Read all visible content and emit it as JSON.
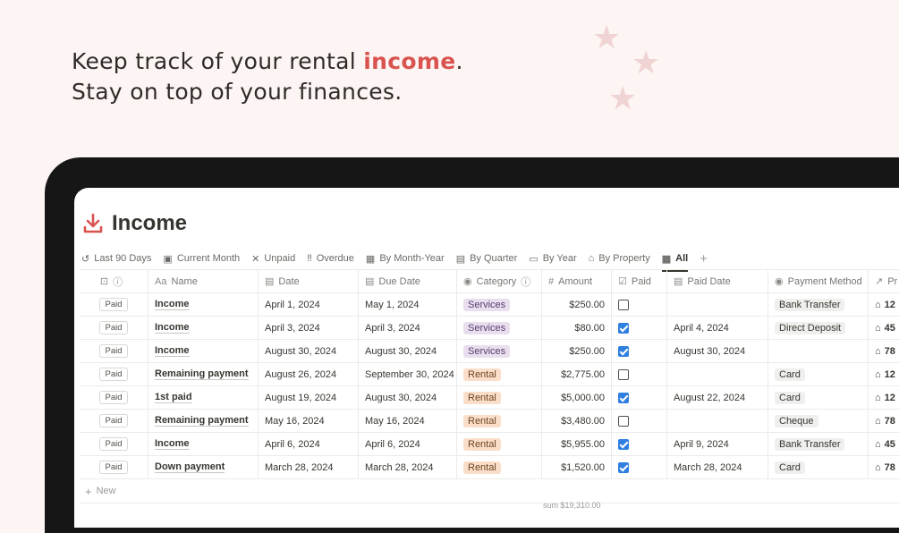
{
  "headline": {
    "line1_prefix": "Keep track of your rental ",
    "line1_accent": "income",
    "line1_suffix": ".",
    "line2": "Stay on top of your finances."
  },
  "colors": {
    "accent": "#d9534f",
    "checkbox": "#2f7fe0",
    "services_tag": "#e8deee",
    "rental_tag": "#fadec9"
  },
  "page": {
    "title": "Income",
    "icon": "download-icon"
  },
  "tabs": [
    {
      "label": "Last 90 Days",
      "icon": "history-icon"
    },
    {
      "label": "Current Month",
      "icon": "calendar-folder-icon"
    },
    {
      "label": "Unpaid",
      "icon": "x-icon"
    },
    {
      "label": "Overdue",
      "icon": "double-exclamation-icon"
    },
    {
      "label": "By Month-Year",
      "icon": "calendar-grid-icon"
    },
    {
      "label": "By Quarter",
      "icon": "board-icon"
    },
    {
      "label": "By Year",
      "icon": "calendar-icon"
    },
    {
      "label": "By Property",
      "icon": "house-icon"
    },
    {
      "label": "All",
      "icon": "table-icon",
      "active": true
    }
  ],
  "table": {
    "headers": {
      "status": "",
      "name": "Name",
      "date": "Date",
      "due_date": "Due Date",
      "category": "Category",
      "amount": "Amount",
      "paid": "Paid",
      "paid_date": "Paid Date",
      "payment_method": "Payment Method",
      "property": "Pr"
    },
    "header_icons": {
      "name": "Aa",
      "amount": "#"
    },
    "rows": [
      {
        "status": "Paid",
        "name": "Income",
        "date": "April 1, 2024",
        "due_date": "May 1, 2024",
        "category": "Services",
        "amount": "$250.00",
        "paid": false,
        "paid_date": "",
        "payment_method": "Bank Transfer",
        "property": "12"
      },
      {
        "status": "Paid",
        "name": "Income",
        "date": "April 3, 2024",
        "due_date": "April 3, 2024",
        "category": "Services",
        "amount": "$80.00",
        "paid": true,
        "paid_date": "April 4, 2024",
        "payment_method": "Direct Deposit",
        "property": "45"
      },
      {
        "status": "Paid",
        "name": "Income",
        "date": "August 30, 2024",
        "due_date": "August 30, 2024",
        "category": "Services",
        "amount": "$250.00",
        "paid": true,
        "paid_date": "August 30, 2024",
        "payment_method": "",
        "property": "78"
      },
      {
        "status": "Paid",
        "name": "Remaining payment",
        "date": "August 26, 2024",
        "due_date": "September 30, 2024",
        "category": "Rental",
        "amount": "$2,775.00",
        "paid": false,
        "paid_date": "",
        "payment_method": "Card",
        "property": "12"
      },
      {
        "status": "Paid",
        "name": "1st paid",
        "date": "August 19, 2024",
        "due_date": "August 30, 2024",
        "category": "Rental",
        "amount": "$5,000.00",
        "paid": true,
        "paid_date": "August 22, 2024",
        "payment_method": "Card",
        "property": "12"
      },
      {
        "status": "Paid",
        "name": "Remaining payment",
        "date": "May 16, 2024",
        "due_date": "May 16, 2024",
        "category": "Rental",
        "amount": "$3,480.00",
        "paid": false,
        "paid_date": "",
        "payment_method": "Cheque",
        "property": "78"
      },
      {
        "status": "Paid",
        "name": "Income",
        "date": "April 6, 2024",
        "due_date": "April 6, 2024",
        "category": "Rental",
        "amount": "$5,955.00",
        "paid": true,
        "paid_date": "April 9, 2024",
        "payment_method": "Bank Transfer",
        "property": "45"
      },
      {
        "status": "Paid",
        "name": "Down payment",
        "date": "March 28, 2024",
        "due_date": "March 28, 2024",
        "category": "Rental",
        "amount": "$1,520.00",
        "paid": true,
        "paid_date": "March 28, 2024",
        "payment_method": "Card",
        "property": "78"
      }
    ],
    "new_label": "New",
    "sum_text": "sum $19,310.00"
  }
}
